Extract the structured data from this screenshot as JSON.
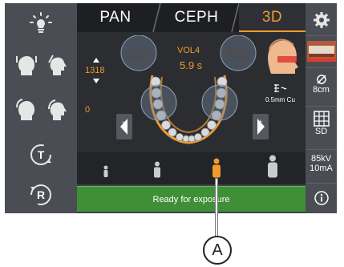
{
  "tabs": [
    {
      "label": "PAN",
      "active": false
    },
    {
      "label": "CEPH",
      "active": false
    },
    {
      "label": "3D",
      "active": true
    }
  ],
  "main": {
    "height_value": "1318",
    "vertical_offset": "0",
    "volume": "VOL4",
    "exposure_time": "5.9 s",
    "filter": "0.5mm Cu"
  },
  "right_bar": {
    "fov_diameter": "8cm",
    "resolution": "SD",
    "kv": "85kV",
    "ma": "10mA"
  },
  "left_bar": {
    "t_button": "T",
    "r_button": "R"
  },
  "status": "Ready for exposure",
  "callout": "A",
  "colors": {
    "accent": "#f29a2e",
    "status_ready": "#3f8f37",
    "panel_bg": "#3d4046"
  }
}
